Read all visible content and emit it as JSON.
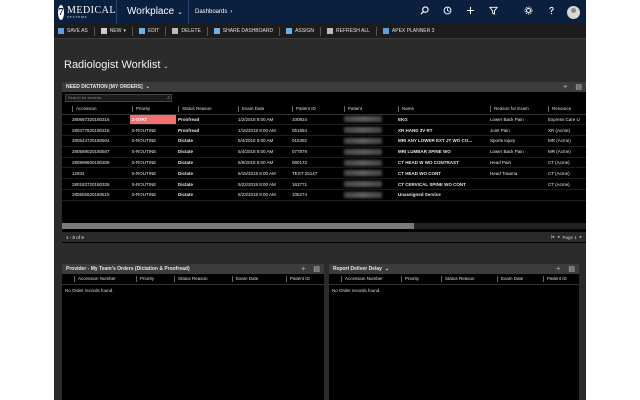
{
  "nav": {
    "logo_brand": "MEDICAL",
    "logo_sub": "SYSTEMS",
    "logo_seven": "7",
    "app_name": "Workplace",
    "area": "Dashboards",
    "icons": [
      "search-icon",
      "history-icon",
      "add-icon",
      "filter-icon",
      "settings-icon",
      "help-icon",
      "user-avatar"
    ]
  },
  "commands": [
    {
      "label": "SAVE AS",
      "icon": "save-icon",
      "color": "#5aa0e6"
    },
    {
      "label": "NEW",
      "icon": "new-icon",
      "color": "#cccccc",
      "dropdown": "▾"
    },
    {
      "label": "EDIT",
      "icon": "edit-icon",
      "color": "#6bb0e8"
    },
    {
      "label": "DELETE",
      "icon": "delete-icon",
      "color": "#bbbbbb"
    },
    {
      "label": "SHARE DASHBOARD",
      "icon": "share-icon",
      "color": "#6bb0e8"
    },
    {
      "label": "ASSIGN",
      "icon": "assign-icon",
      "color": "#6bb0e8"
    },
    {
      "label": "REFRESH ALL",
      "icon": "refresh-icon",
      "color": "#bbbbbb"
    },
    {
      "label": "APEX PLANNER 3",
      "icon": "planner-icon",
      "color": "#5aa0e6"
    }
  ],
  "page_title": "Radiologist Worklist",
  "worklist": {
    "title": "NEED DICTATION [MY ORDERS]",
    "search_placeholder": "Search for records",
    "columns": [
      "Accession",
      "Priority",
      "Status Reason",
      "Exam Date",
      "Patient ID",
      "Patient",
      "Name",
      "Reason for Exam",
      "Resource"
    ],
    "rows": [
      {
        "accession": "280667320180316",
        "priority": "2-STAT",
        "status": "Proofread",
        "date": "1/2/2018 8:00 AM",
        "pid": "100924",
        "name": "EKG",
        "reason": "Lower Back Pain",
        "resource": "Express Care U"
      },
      {
        "accession": "280477820180316",
        "priority": "5-ROUTINE",
        "status": "Proofread",
        "date": "1/16/2018 8:00 AM",
        "pid": "051584",
        "name": "XR HAND 3V RT",
        "reason": "Joint Pain",
        "resource": "XR (Acme)"
      },
      {
        "accession": "280544720180504",
        "priority": "5-ROUTINE",
        "status": "Dictate",
        "date": "5/4/2018 8:00 AM",
        "pid": "015392",
        "name": "MRI ANY LOWER EXT JT WO CO...",
        "reason": "Sports Injury",
        "resource": "MR (Acme)"
      },
      {
        "accession": "280569020180507",
        "priority": "5-ROUTINE",
        "status": "Dictate",
        "date": "5/4/2018 8:00 AM",
        "pid": "077879",
        "name": "MRI LUMBAR SPINE WO",
        "reason": "Lower Back Pain",
        "resource": "MR (Acme)"
      },
      {
        "accession": "280999600180309",
        "priority": "5-ROUTINE",
        "status": "Dictate",
        "date": "5/9/2018 8:00 AM",
        "pid": "080172",
        "name": "CT HEAD W WO CONTRAST",
        "reason": "Head Pain",
        "resource": "CT (Acme)"
      },
      {
        "accession": "12934",
        "priority": "5-ROUTINE",
        "status": "Dictate",
        "date": "5/15/2018 8:00 AM",
        "pid": "TEST-25147",
        "name": "CT HEAD WO CONT",
        "reason": "Head Trauma",
        "resource": "CT (Acme)"
      },
      {
        "accession": "280183720180326",
        "priority": "5-ROUTINE",
        "status": "Dictate",
        "date": "5/22/2018 8:00 AM",
        "pid": "163771",
        "name": "CT CERVICAL SPINE WO CONT",
        "reason": "",
        "resource": "CT (Acme)"
      },
      {
        "accession": "280655620180515",
        "priority": "5-ROUTINE",
        "status": "Dictate",
        "date": "5/23/2018 8:00 AM",
        "pid": "105274",
        "name": "Unassigned Service",
        "reason": "",
        "resource": ""
      }
    ],
    "record_count": "1 - 8 of 9",
    "page_label": "Page 1",
    "pager_first": "|◂",
    "pager_prev": "◂",
    "pager_next": "▸"
  },
  "panel_left": {
    "title": "Provider - My Team's Orders (Dictation & Proofread)",
    "columns": [
      "Accession Number",
      "Priority",
      "Status Reason",
      "Exam Date",
      "Patient ID"
    ],
    "empty": "No Order records found."
  },
  "panel_right": {
    "title": "Report Deliver Delay",
    "columns": [
      "Accession Number",
      "Priority",
      "Status Reason",
      "Exam Date",
      "Patient ID"
    ],
    "empty": "No Order records found."
  },
  "colors": {
    "nav": "#0b1f3f",
    "stat": "#f26f6f",
    "background": "#2b2b2b"
  }
}
